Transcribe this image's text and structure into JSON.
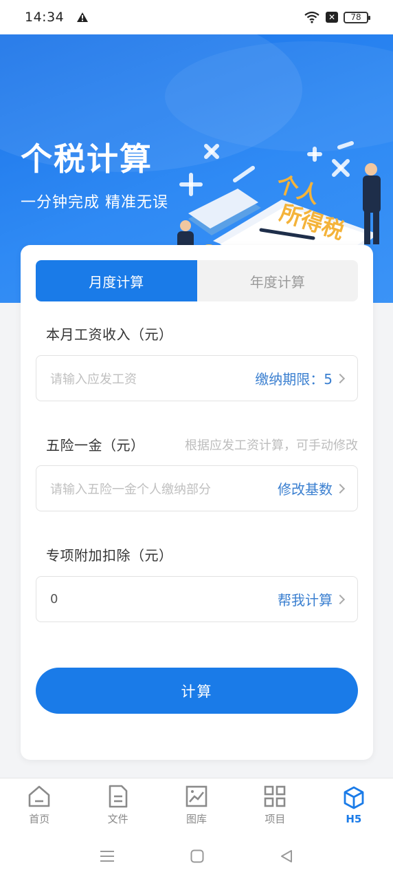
{
  "status": {
    "time": "14:34",
    "battery": "78"
  },
  "hero": {
    "title": "个税计算",
    "subtitle": "一分钟完成  精准无误",
    "art_text_1": "个人",
    "art_text_2": "所得税"
  },
  "tabs": [
    {
      "label": "月度计算",
      "active": true
    },
    {
      "label": "年度计算",
      "active": false
    }
  ],
  "form": {
    "salary": {
      "label": "本月工资收入（元）",
      "placeholder": "请输入应发工资",
      "action": "缴纳期限：5"
    },
    "insurance": {
      "label": "五险一金（元）",
      "hint": "根据应发工资计算，可手动修改",
      "placeholder": "请输入五险一金个人缴纳部分",
      "action": "修改基数"
    },
    "deduction": {
      "label": "专项附加扣除（元）",
      "value": "0",
      "action": "帮我计算"
    }
  },
  "submit_label": "计算",
  "nav": [
    {
      "label": "首页",
      "icon": "home-icon"
    },
    {
      "label": "文件",
      "icon": "file-icon"
    },
    {
      "label": "图库",
      "icon": "gallery-icon"
    },
    {
      "label": "项目",
      "icon": "grid-icon"
    },
    {
      "label": "H5",
      "icon": "cube-icon",
      "active": true
    }
  ],
  "colors": {
    "primary": "#1a7be8",
    "link": "#3a7fd0"
  }
}
